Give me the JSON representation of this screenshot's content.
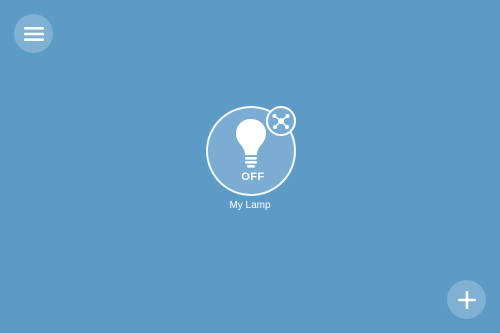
{
  "icons": {
    "menu": "hamburger-menu-icon",
    "bulb": "light-bulb-icon",
    "hub": "hub-network-icon",
    "add": "plus-icon"
  },
  "colors": {
    "background": "#5d9bc7",
    "foreground": "#ffffff"
  },
  "device": {
    "name": "My Lamp",
    "state": "OFF"
  }
}
